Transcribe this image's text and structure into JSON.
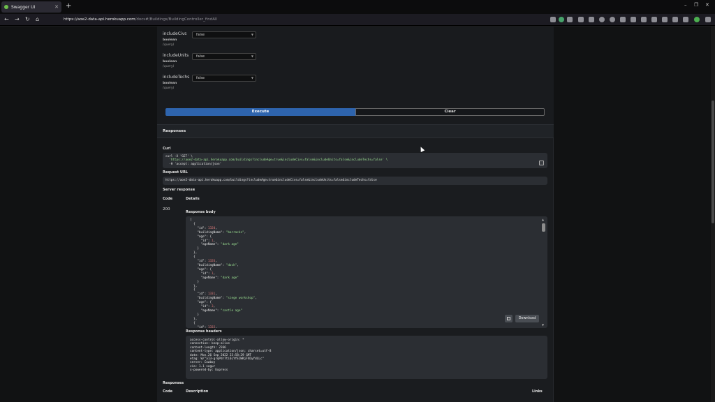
{
  "browser": {
    "tab_title": "Swagger UI",
    "tab_close": "✕",
    "new_tab": "+",
    "url_host": "https://aoe2-data-api.herokuapp.com",
    "url_path": "/docs#/Buildings/BuildingController_findAll",
    "win_min": "–",
    "win_max": "❐",
    "win_close": "✕",
    "nav_back": "←",
    "nav_forward": "→",
    "nav_reload": "↻",
    "nav_home": "⌂"
  },
  "params": [
    {
      "name": "includeCivs",
      "type": "boolean",
      "in": "(query)",
      "value": "false"
    },
    {
      "name": "includeUnits",
      "type": "boolean",
      "in": "(query)",
      "value": "false"
    },
    {
      "name": "includeTechs",
      "type": "boolean",
      "in": "(query)",
      "value": "false"
    }
  ],
  "buttons": {
    "execute": "Execute",
    "clear": "Clear",
    "download": "Download"
  },
  "responses_title": "Responses",
  "curl": {
    "label": "Curl",
    "line1": "curl -X 'GET' \\",
    "line2": "  'https://aoe2-data-api.herokuapp.com/buildings?includeAge=true&includeCivs=false&includeUnits=false&includeTechs=false' \\",
    "line3": "  -H 'accept: application/json'"
  },
  "request_url": {
    "label": "Request URL",
    "value": "https://aoe2-data-api.herokuapp.com/buildings?includeAge=true&includeCivs=false&includeUnits=false&includeTechs=false"
  },
  "server_response": {
    "label": "Server response",
    "code_header": "Code",
    "details_header": "Details",
    "code": "200",
    "body_label": "Response body",
    "headers_label": "Response headers",
    "body_lines": [
      {
        "t": "["
      },
      {
        "t": "  {"
      },
      {
        "k": "    \"id\": ",
        "n": "1320",
        "e": ","
      },
      {
        "k": "    \"buildingName\": ",
        "s": "\"barracks\"",
        "e": ","
      },
      {
        "k": "    \"age\": {"
      },
      {
        "k": "      \"id\": ",
        "n": "1",
        "e": ","
      },
      {
        "k": "      \"ageName\": ",
        "s": "\"dark age\""
      },
      {
        "t": "    }"
      },
      {
        "t": "  },"
      },
      {
        "t": "  {"
      },
      {
        "k": "    \"id\": ",
        "n": "1326",
        "e": ","
      },
      {
        "k": "    \"buildingName\": ",
        "s": "\"dock\"",
        "e": ","
      },
      {
        "k": "    \"age\": {"
      },
      {
        "k": "      \"id\": ",
        "n": "1",
        "e": ","
      },
      {
        "k": "      \"ageName\": ",
        "s": "\"dark age\""
      },
      {
        "t": "    }"
      },
      {
        "t": "  },"
      },
      {
        "t": "  {"
      },
      {
        "k": "    \"id\": ",
        "n": "1331",
        "e": ","
      },
      {
        "k": "    \"buildingName\": ",
        "s": "\"siege workshop\"",
        "e": ","
      },
      {
        "k": "    \"age\": {"
      },
      {
        "k": "      \"id\": ",
        "n": "3",
        "e": ","
      },
      {
        "k": "      \"ageName\": ",
        "s": "\"castle age\""
      },
      {
        "t": "    }"
      },
      {
        "t": "  },"
      },
      {
        "t": "  {"
      },
      {
        "k": "    \"id\": ",
        "n": "1332",
        "e": ","
      }
    ],
    "header_lines": [
      "access-control-allow-origin: *",
      "connection: keep-alive",
      "content-length: 2366",
      "content-type: application/json; charset=utf-8",
      "date: Mon,26 Sep 2022 23:58:29 GMT",
      "etag: W/\"a13-grqPdr7ti6LYfE1WKjFhDyYdLLc\"",
      "server: Cowboy",
      "via: 1.1 vegur",
      "x-powered-by: Express"
    ]
  },
  "bottom": {
    "responses": "Responses",
    "code": "Code",
    "description": "Description",
    "links": "Links"
  }
}
